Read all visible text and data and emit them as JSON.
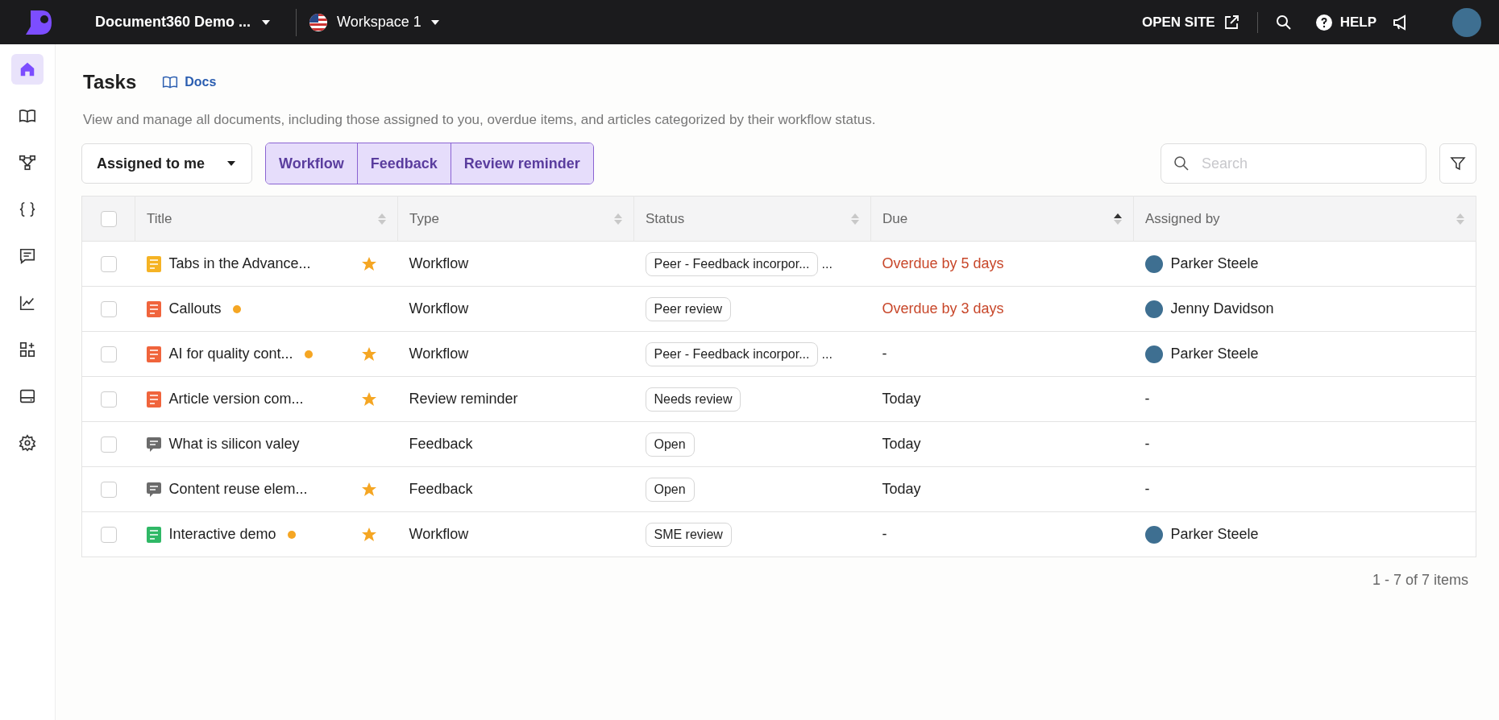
{
  "topbar": {
    "project": "Document360 Demo ...",
    "workspace": "Workspace 1",
    "open_site": "OPEN SITE",
    "help": "HELP"
  },
  "sidebar": {
    "items": [
      {
        "selected": true
      },
      {
        "selected": false
      },
      {
        "selected": false
      },
      {
        "selected": false
      },
      {
        "selected": false
      },
      {
        "selected": false
      },
      {
        "selected": false
      },
      {
        "selected": false
      },
      {
        "selected": false
      }
    ]
  },
  "page": {
    "title": "Tasks",
    "docs_link": "Docs",
    "description": "View and manage all documents, including those assigned to you, overdue items, and articles categorized by their workflow status."
  },
  "toolbar": {
    "dropdown": "Assigned to me",
    "segments": [
      {
        "label": "Workflow",
        "selected": true
      },
      {
        "label": "Feedback",
        "selected": true
      },
      {
        "label": "Review reminder",
        "selected": true
      }
    ],
    "search": {
      "placeholder": "Search"
    }
  },
  "table": {
    "all_checked": false,
    "columns": [
      {
        "label": "Title",
        "sorted": false
      },
      {
        "label": "Type",
        "sorted": false
      },
      {
        "label": "Status",
        "sorted": false
      },
      {
        "label": "Due",
        "sorted": true
      },
      {
        "label": "Assigned by",
        "sorted": false
      }
    ],
    "rows": [
      {
        "checked": false,
        "kind": "article",
        "color": "#f5b324",
        "title": "Tabs in the Advance...",
        "dot": false,
        "starred": true,
        "type": "Workflow",
        "status": "Peer - Feedback incorpor...",
        "status_more": "...",
        "due": "Overdue by 5 days",
        "overdue": true,
        "assigned_by": "Parker Steele"
      },
      {
        "checked": false,
        "kind": "article",
        "color": "#f0643c",
        "title": "Callouts",
        "dot": true,
        "starred": false,
        "type": "Workflow",
        "status": "Peer review",
        "due": "Overdue by 3 days",
        "overdue": true,
        "assigned_by": "Jenny Davidson"
      },
      {
        "checked": false,
        "kind": "article",
        "color": "#f0643c",
        "title": "AI for quality cont...",
        "dot": true,
        "starred": true,
        "type": "Workflow",
        "status": "Peer - Feedback incorpor...",
        "status_more": "...",
        "due": "-",
        "overdue": false,
        "assigned_by": "Parker Steele"
      },
      {
        "checked": false,
        "kind": "article",
        "color": "#f0643c",
        "title": "Article version com...",
        "dot": false,
        "starred": true,
        "type": "Review reminder",
        "status": "Needs review",
        "due": "Today",
        "overdue": false,
        "assigned_by": "-"
      },
      {
        "checked": false,
        "kind": "feedback",
        "color": "#6b6b6b",
        "title": "What is silicon valey",
        "dot": false,
        "starred": false,
        "type": "Feedback",
        "status": "Open",
        "due": "Today",
        "overdue": false,
        "assigned_by": "-"
      },
      {
        "checked": false,
        "kind": "feedback",
        "color": "#6b6b6b",
        "title": "Content reuse elem...",
        "dot": false,
        "starred": true,
        "type": "Feedback",
        "status": "Open",
        "due": "Today",
        "overdue": false,
        "assigned_by": "-"
      },
      {
        "checked": false,
        "kind": "article",
        "color": "#2fb866",
        "title": "Interactive demo",
        "dot": true,
        "starred": true,
        "type": "Workflow",
        "status": "SME review",
        "due": "-",
        "overdue": false,
        "assigned_by": "Parker Steele"
      }
    ],
    "pagination": "1 - 7 of 7 items"
  }
}
